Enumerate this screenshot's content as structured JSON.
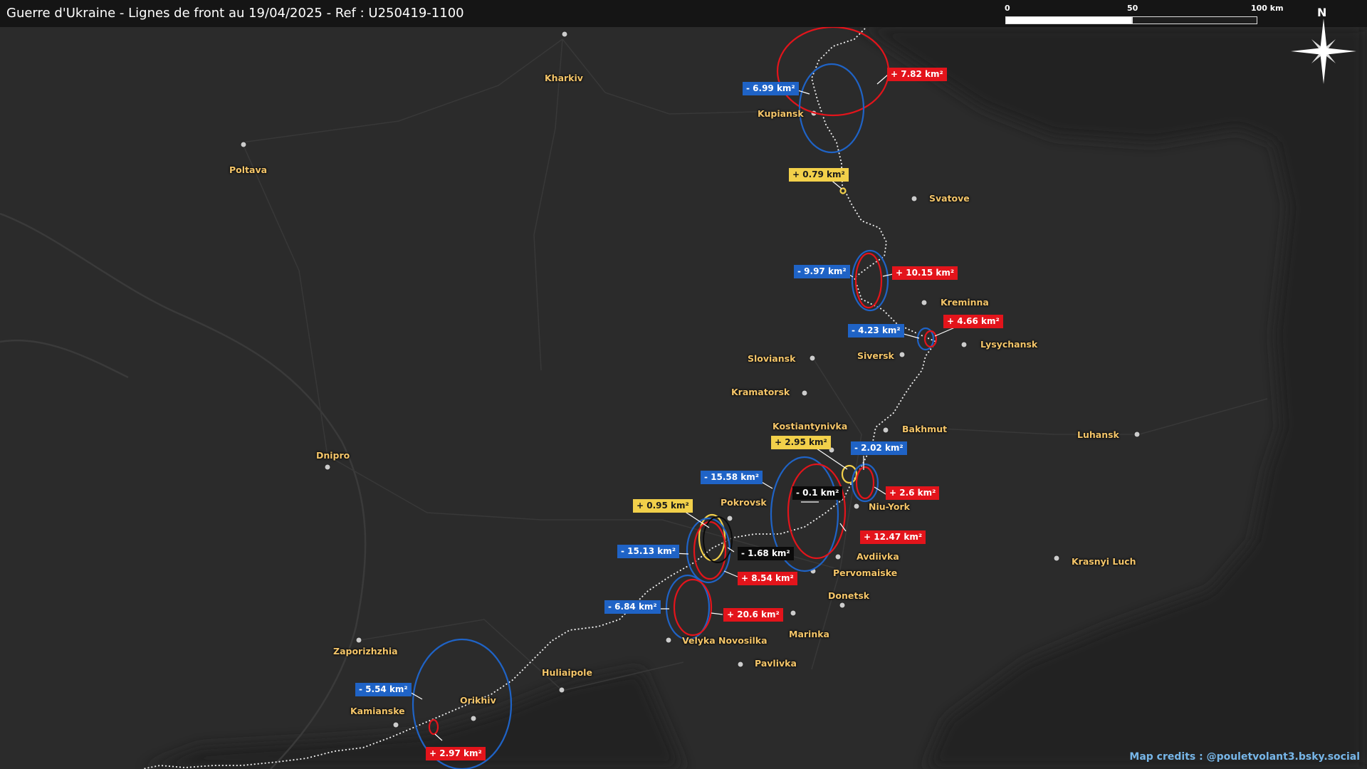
{
  "header": {
    "title": "Guerre d'Ukraine - Lignes de front au 19/04/2025 - Ref : U250419-1100"
  },
  "scale_bar": {
    "labels": [
      "0",
      "50",
      "100 km"
    ]
  },
  "compass": {
    "north_label": "N",
    "icon": "compass-rose-icon"
  },
  "colors": {
    "gain": "#e3141b",
    "loss": "#1f63c6",
    "minor": "#f2d04a",
    "neutral": "#0b0b0b",
    "city_label": "#f5c66a",
    "credits": "#77b6e8",
    "front_line": "#ffffff"
  },
  "cities": [
    {
      "name": "Kharkiv"
    },
    {
      "name": "Kupiansk"
    },
    {
      "name": "Poltava"
    },
    {
      "name": "Svatove"
    },
    {
      "name": "Kreminna"
    },
    {
      "name": "Lysychansk"
    },
    {
      "name": "Siversk"
    },
    {
      "name": "Sloviansk"
    },
    {
      "name": "Kramatorsk"
    },
    {
      "name": "Kostiantynivka"
    },
    {
      "name": "Bakhmut"
    },
    {
      "name": "Luhansk"
    },
    {
      "name": "Dnipro"
    },
    {
      "name": "Pokrovsk"
    },
    {
      "name": "Niu-York"
    },
    {
      "name": "Avdiivka"
    },
    {
      "name": "Pervomaiske"
    },
    {
      "name": "Krasnyi Luch"
    },
    {
      "name": "Donetsk"
    },
    {
      "name": "Marinka"
    },
    {
      "name": "Velyka Novosilka"
    },
    {
      "name": "Pavlivka"
    },
    {
      "name": "Zaporizhzhia"
    },
    {
      "name": "Huliaipole"
    },
    {
      "name": "Orikhiv"
    },
    {
      "name": "Kamianske"
    }
  ],
  "area_changes": [
    {
      "text": "+ 7.82 km²",
      "kind": "gain"
    },
    {
      "text": "- 6.99 km²",
      "kind": "loss"
    },
    {
      "text": "+ 0.79 km²",
      "kind": "minor"
    },
    {
      "text": "- 9.97 km²",
      "kind": "loss"
    },
    {
      "text": "+ 10.15 km²",
      "kind": "gain"
    },
    {
      "text": "- 4.23 km²",
      "kind": "loss"
    },
    {
      "text": "+ 4.66 km²",
      "kind": "gain"
    },
    {
      "text": "+ 2.95 km²",
      "kind": "minor"
    },
    {
      "text": "- 2.02 km²",
      "kind": "loss"
    },
    {
      "text": "- 15.58 km²",
      "kind": "loss"
    },
    {
      "text": "- 0.1 km²",
      "kind": "neutral"
    },
    {
      "text": "+ 2.6 km²",
      "kind": "gain"
    },
    {
      "text": "+ 0.95 km²",
      "kind": "minor"
    },
    {
      "text": "+ 12.47 km²",
      "kind": "gain"
    },
    {
      "text": "- 15.13 km²",
      "kind": "loss"
    },
    {
      "text": "- 1.68 km²",
      "kind": "neutral"
    },
    {
      "text": "+ 8.54 km²",
      "kind": "gain"
    },
    {
      "text": "- 6.84 km²",
      "kind": "loss"
    },
    {
      "text": "+ 20.6 km²",
      "kind": "gain"
    },
    {
      "text": "- 5.54 km²",
      "kind": "loss"
    },
    {
      "text": "+ 2.97 km²",
      "kind": "gain"
    }
  ],
  "credits": "Map credits : @pouletvolant3.bsky.social"
}
